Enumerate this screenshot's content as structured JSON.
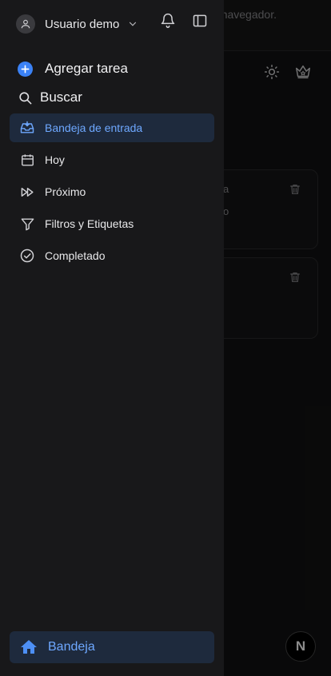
{
  "background": {
    "banner_text": "navegador.",
    "toolbar": {
      "theme_icon": "sun-icon",
      "premium_icon": "crown-icon"
    },
    "cards": [
      {
        "fragment": "a",
        "sub_fragment": "o",
        "trash_icon": "trash-icon"
      },
      {
        "fragment": "",
        "sub_fragment": "",
        "trash_icon": "trash-icon"
      }
    ],
    "fab_label": "N"
  },
  "sidebar": {
    "user": {
      "name": "Usuario demo",
      "avatar_icon": "user-icon",
      "menu_icon": "chevron-down-icon"
    },
    "header_icons": {
      "notifications": "bell-icon",
      "toggle_sidebar": "sidebar-panel-icon"
    },
    "actions": {
      "add_task": "Agregar tarea",
      "search": "Buscar"
    },
    "nav_items": [
      {
        "label": "Bandeja de entrada",
        "icon": "inbox-icon",
        "active": true
      },
      {
        "label": "Hoy",
        "icon": "calendar-icon",
        "active": false
      },
      {
        "label": "Próximo",
        "icon": "fast-forward-icon",
        "active": false
      },
      {
        "label": "Filtros y Etiquetas",
        "icon": "filter-icon",
        "active": false
      },
      {
        "label": "Completado",
        "icon": "check-circle-icon",
        "active": false
      }
    ],
    "bottom_nav": {
      "label": "Bandeja",
      "icon": "home-icon"
    }
  },
  "colors": {
    "accent": "#3b82f6",
    "active_text": "#6ea8ff",
    "active_bg": "#1e2a3d",
    "sidebar_bg": "#18181a"
  }
}
